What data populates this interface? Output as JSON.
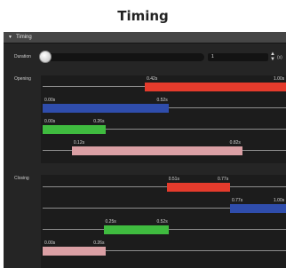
{
  "caption": "Timing",
  "panel": {
    "title": "Timing",
    "collapse_icon": "triangle-down-icon"
  },
  "duration": {
    "label": "Duration",
    "slider_fraction": 0.0,
    "value": "1",
    "unit": "(s)"
  },
  "opening": {
    "label": "Opening",
    "tracks": [
      {
        "start": "0.42s",
        "end": "1.00s",
        "color": "#e53b2c"
      },
      {
        "start": "0.00s",
        "end": "0.52s",
        "color": "#2f4dac"
      },
      {
        "start": "0.00s",
        "end": "0.26s",
        "color": "#3fbb3f"
      },
      {
        "start": "0.12s",
        "end": "0.82s",
        "color": "#dba0a5"
      }
    ]
  },
  "closing": {
    "label": "Closing",
    "tracks": [
      {
        "start": "0.51s",
        "end": "0.77s",
        "color": "#e53b2c"
      },
      {
        "start": "0.77s",
        "end": "1.00s",
        "color": "#2f4dac"
      },
      {
        "start": "0.25s",
        "end": "0.52s",
        "color": "#3fbb3f"
      },
      {
        "start": "0.00s",
        "end": "0.26s",
        "color": "#dba0a5"
      }
    ]
  }
}
